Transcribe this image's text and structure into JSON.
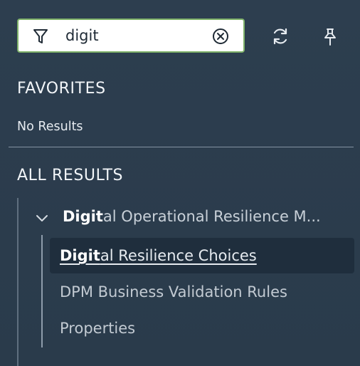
{
  "search": {
    "value": "digit",
    "placeholder": ""
  },
  "favorites": {
    "title": "FAVORITES",
    "empty_text": "No Results"
  },
  "results": {
    "title": "ALL RESULTS",
    "group": {
      "label_match": "Digit",
      "label_rest": "al Operational Resilience M...",
      "expanded": true
    },
    "items": [
      {
        "match": "Digit",
        "rest": "al Resilience Choices",
        "selected": true
      },
      {
        "label": "DPM Business Validation Rules",
        "selected": false
      },
      {
        "label": "Properties",
        "selected": false
      }
    ]
  },
  "icons": {
    "filter": "filter-icon",
    "clear": "clear-circle-x-icon",
    "refresh": "refresh-icon",
    "pin": "pin-icon",
    "chevron": "chevron-down-icon"
  },
  "colors": {
    "background": "#2b3c4d",
    "search_border": "#7fb26a",
    "selected_row": "#1f2e3d",
    "divider": "#8594a3"
  }
}
